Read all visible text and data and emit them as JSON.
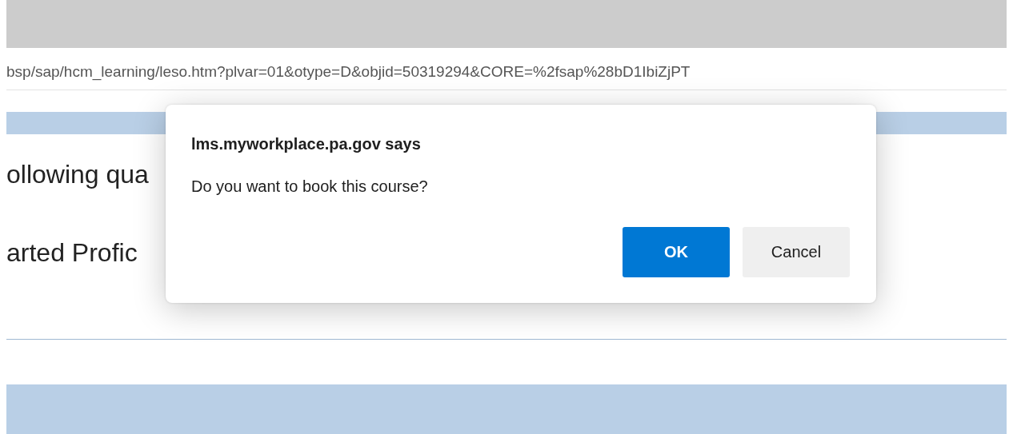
{
  "address_bar": {
    "url": "bsp/sap/hcm_learning/leso.htm?plvar=01&otype=D&objid=50319294&CORE=%2fsap%28bD1IbiZjPT"
  },
  "page": {
    "lines": [
      "ollowing qua",
      "arted Profic"
    ]
  },
  "dialog": {
    "title": "lms.myworkplace.pa.gov says",
    "message": "Do you want to book this course?",
    "buttons": [
      {
        "label": "OK",
        "kind": "primary"
      },
      {
        "label": "Cancel",
        "kind": "secondary"
      }
    ]
  }
}
